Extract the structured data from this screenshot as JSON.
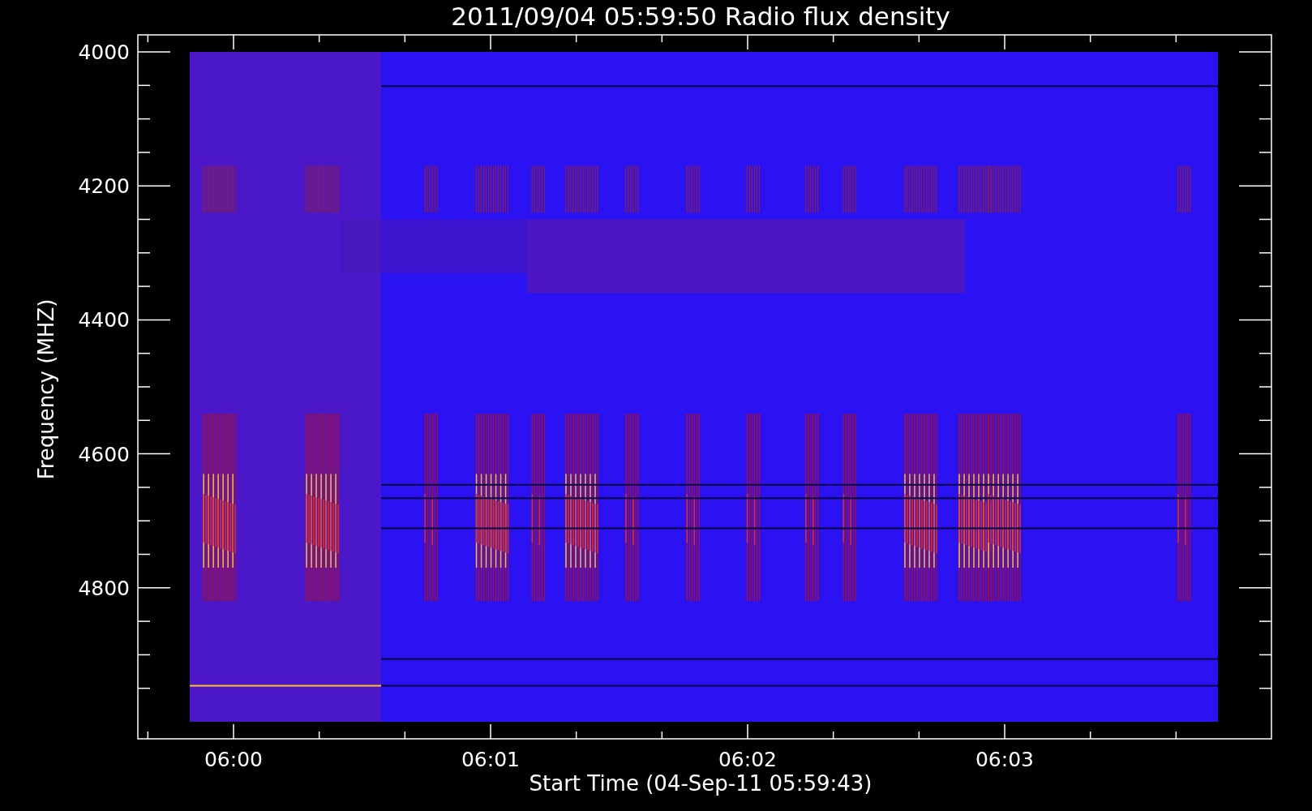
{
  "title": "2011/09/04 05:59:50 Radio flux density",
  "y_axis": {
    "label": "Frequency (MHZ)",
    "ticks": [
      "4000",
      "4200",
      "4400",
      "4600",
      "4800"
    ]
  },
  "x_axis": {
    "label": "Start Time (04-Sep-11 05:59:43)",
    "ticks": [
      "06:00",
      "06:01",
      "06:02",
      "06:03"
    ]
  }
}
